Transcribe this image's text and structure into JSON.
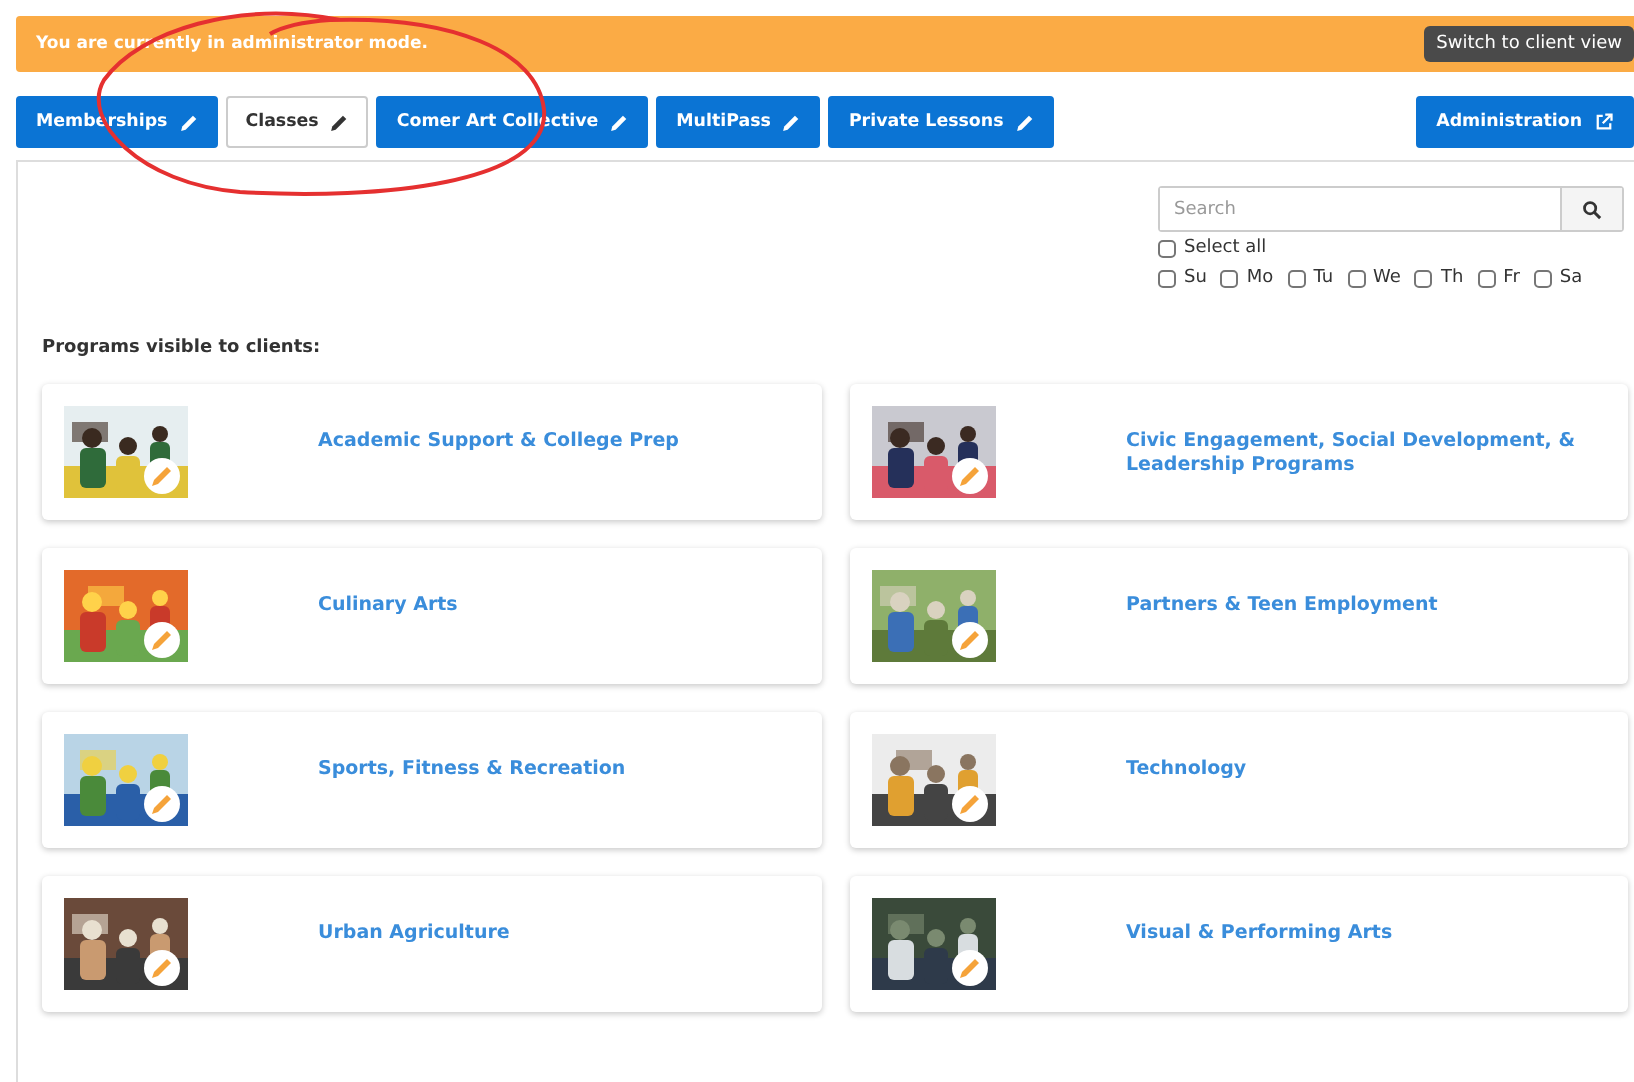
{
  "banner": {
    "message": "You are currently in administrator mode.",
    "button": "Switch to client view"
  },
  "tabs": [
    {
      "label": "Memberships",
      "selected": false,
      "kind": "edit"
    },
    {
      "label": "Classes",
      "selected": true,
      "kind": "edit"
    },
    {
      "label": "Comer Art Collective",
      "selected": false,
      "kind": "edit"
    },
    {
      "label": "MultiPass",
      "selected": false,
      "kind": "edit"
    },
    {
      "label": "Private Lessons",
      "selected": false,
      "kind": "edit"
    },
    {
      "label": "Administration",
      "selected": false,
      "kind": "external"
    }
  ],
  "search": {
    "placeholder": "Search"
  },
  "select_all": {
    "label": "Select all",
    "checked": false
  },
  "days": [
    {
      "label": "Su",
      "checked": false
    },
    {
      "label": "Mo",
      "checked": false
    },
    {
      "label": "Tu",
      "checked": false
    },
    {
      "label": "We",
      "checked": false
    },
    {
      "label": "Th",
      "checked": false
    },
    {
      "label": "Fr",
      "checked": false
    },
    {
      "label": "Sa",
      "checked": false
    }
  ],
  "section_title": "Programs visible to clients:",
  "programs": [
    {
      "title": "Academic Support & College Prep"
    },
    {
      "title": "Civic Engagement, Social Development, & Leadership Programs"
    },
    {
      "title": "Culinary Arts"
    },
    {
      "title": "Partners & Teen Employment"
    },
    {
      "title": "Sports, Fitness & Recreation"
    },
    {
      "title": "Technology"
    },
    {
      "title": "Urban Agriculture"
    },
    {
      "title": "Visual & Performing Arts"
    }
  ]
}
